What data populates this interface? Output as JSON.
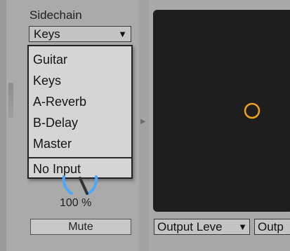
{
  "sidechain": {
    "title": "Sidechain",
    "selected": "Keys",
    "arrow_icon": "dropdown-arrow-icon",
    "options": [
      "Guitar",
      "Keys",
      "A-Reverb",
      "B-Delay",
      "Master"
    ],
    "no_input": "No Input"
  },
  "knob": {
    "value": "100 %"
  },
  "mute": {
    "label": "Mute"
  },
  "output": {
    "select1_text": "Output Leve",
    "select2_text": "Outp"
  },
  "colors": {
    "knob_accent": "#4aa8ff",
    "marker": "#f0a020",
    "display_bg": "#1e1e1e"
  }
}
